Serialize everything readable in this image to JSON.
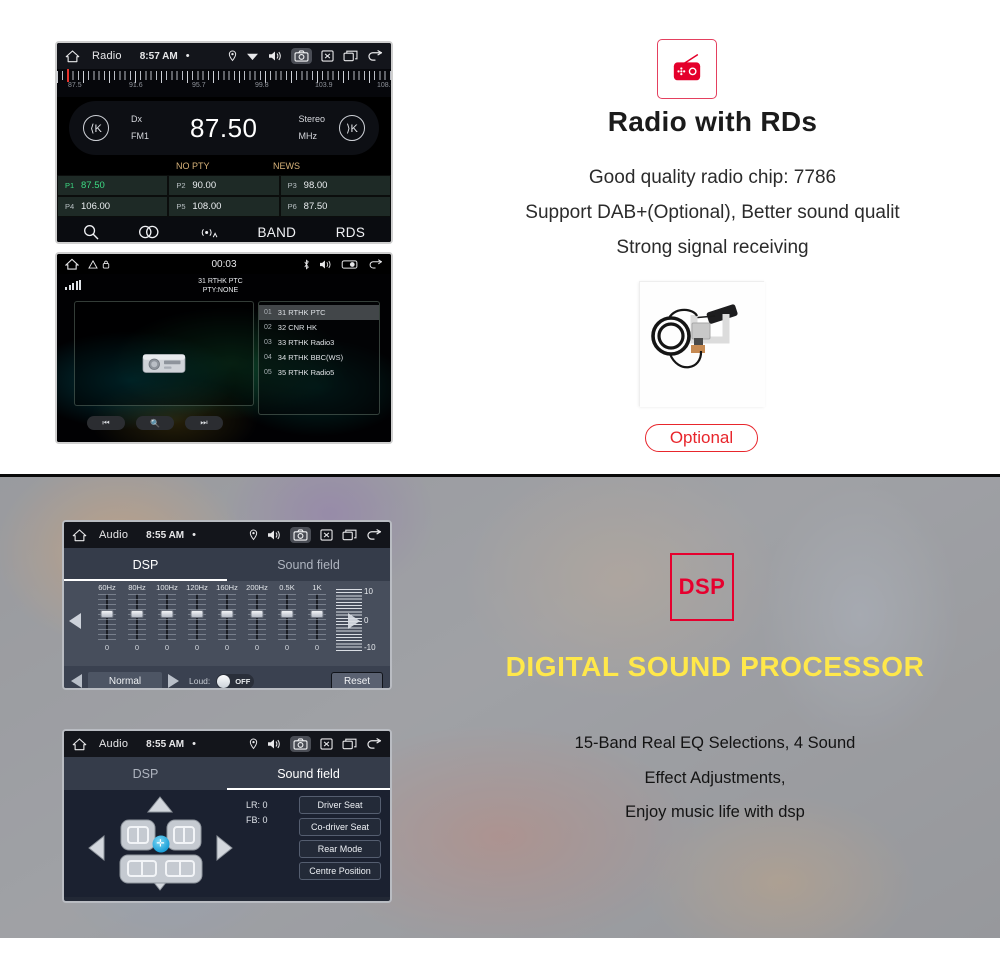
{
  "radio_section": {
    "unit_main": {
      "statusbar": {
        "title": "Radio",
        "time": "8:57 AM",
        "dot": "•",
        "icons": [
          "home-icon",
          "location-pin-icon",
          "wifi-icon",
          "volume-icon",
          "camera-icon",
          "close-icon",
          "recents-icon",
          "back-icon"
        ]
      },
      "tuning": {
        "ticks": [
          "87.5",
          "91.6",
          "95.7",
          "99.8",
          "103.9",
          "108.0"
        ],
        "needle_value": "87.5"
      },
      "display": {
        "prev_icon": "skip-previous-icon",
        "next_icon": "skip-next-icon",
        "left_top": "Dx",
        "left_bottom": "FM1",
        "frequency": "87.50",
        "right_top": "Stereo",
        "right_bottom": "MHz"
      },
      "pty": {
        "no_pty": "NO PTY",
        "news": "NEWS"
      },
      "presets": [
        {
          "num": "P1",
          "freq": "87.50",
          "active": true
        },
        {
          "num": "P2",
          "freq": "90.00",
          "active": false
        },
        {
          "num": "P3",
          "freq": "98.00",
          "active": false
        },
        {
          "num": "P4",
          "freq": "106.00",
          "active": false
        },
        {
          "num": "P5",
          "freq": "108.00",
          "active": false
        },
        {
          "num": "P6",
          "freq": "87.50",
          "active": false
        }
      ],
      "bottom_bar": {
        "search_icon": "search-icon",
        "stereo_icon": "stereo-rings-icon",
        "antenna_icon": "antenna-icon",
        "band_label": "BAND",
        "rds_label": "RDS"
      }
    },
    "unit_rds": {
      "statusbar": {
        "time": "00:03",
        "icons": [
          "home-icon",
          "warning-icon",
          "lock-icon",
          "bluetooth-icon",
          "volume-icon",
          "battery-icon",
          "back-icon"
        ]
      },
      "station_name": "31 RTHK PTC",
      "pty_status": "PTY:NONE",
      "signal_icon": "signal-bars-icon",
      "list": [
        {
          "idx": "01",
          "name": "31 RTHK PTC",
          "selected": true
        },
        {
          "idx": "02",
          "name": "32 CNR HK",
          "selected": false
        },
        {
          "idx": "03",
          "name": "33 RTHK Radio3",
          "selected": false
        },
        {
          "idx": "04",
          "name": "34 RTHK BBC(WS)",
          "selected": false
        },
        {
          "idx": "05",
          "name": "35 RTHK Radio5",
          "selected": false
        }
      ],
      "controls": {
        "prev_icon": "skip-previous-icon",
        "search_icon": "search-icon",
        "next_icon": "skip-next-icon"
      }
    },
    "feature": {
      "icon_name": "radio-icon",
      "icon_color": "#e4405f",
      "title": "Radio with RDs",
      "lines": [
        "Good quality radio chip: 7786",
        "Support DAB+(Optional), Better sound qualit",
        "Strong signal receiving"
      ],
      "photo_name": "dab-antenna-photo",
      "badge": "Optional",
      "badge_color": "#e8262c"
    }
  },
  "dsp_section": {
    "unit_eq": {
      "statusbar": {
        "title": "Audio",
        "time": "8:55 AM",
        "dot": "•"
      },
      "tabs": [
        {
          "label": "DSP",
          "active": true
        },
        {
          "label": "Sound field",
          "active": false
        }
      ],
      "bands": [
        {
          "freq": "60Hz",
          "value": "0"
        },
        {
          "freq": "80Hz",
          "value": "0"
        },
        {
          "freq": "100Hz",
          "value": "0"
        },
        {
          "freq": "120Hz",
          "value": "0"
        },
        {
          "freq": "160Hz",
          "value": "0"
        },
        {
          "freq": "200Hz",
          "value": "0"
        },
        {
          "freq": "0.5K",
          "value": "0"
        },
        {
          "freq": "1K",
          "value": "0"
        }
      ],
      "scale": {
        "top": "10",
        "mid": "0",
        "bottom": "-10"
      },
      "preset_name": "Normal",
      "loud_label": "Loud:",
      "loud_state": "OFF",
      "reset_label": "Reset",
      "arrow_left_icon": "arrow-left-icon",
      "arrow_right_icon": "arrow-right-icon"
    },
    "unit_soundfield": {
      "statusbar": {
        "title": "Audio",
        "time": "8:55 AM",
        "dot": "•"
      },
      "tabs": [
        {
          "label": "DSP",
          "active": false
        },
        {
          "label": "Sound field",
          "active": true
        }
      ],
      "readout": {
        "lr": "LR: 0",
        "fb": "FB: 0"
      },
      "buttons": [
        "Driver Seat",
        "Co-driver Seat",
        "Rear Mode",
        "Centre Position"
      ],
      "center_icon": "position-marker-icon"
    },
    "feature": {
      "badge": "DSP",
      "badge_color": "#e6002e",
      "headline": "DIGITAL SOUND PROCESSOR",
      "headline_color": "#ffe84a",
      "lines": [
        "15-Band Real EQ Selections, 4 Sound",
        "Effect Adjustments,",
        "Enjoy music life with dsp"
      ]
    }
  }
}
